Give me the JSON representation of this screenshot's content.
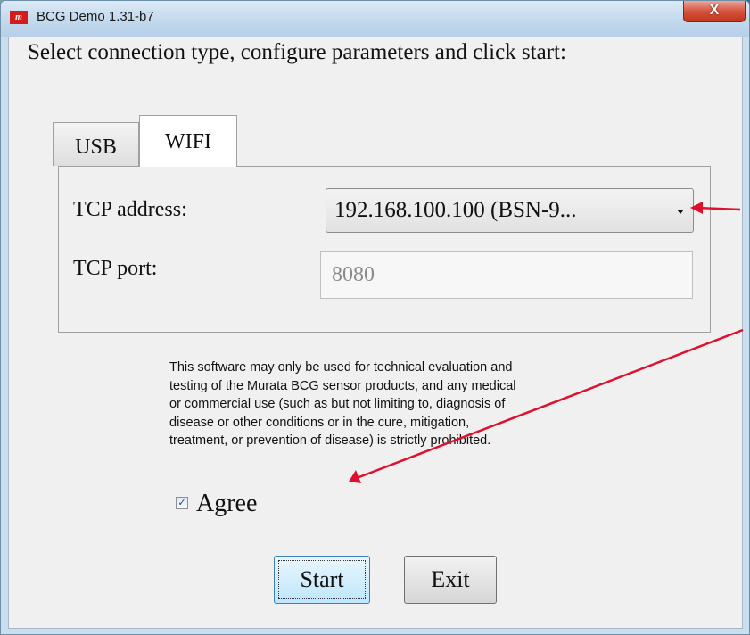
{
  "window": {
    "app_icon_text": "m",
    "title": "BCG Demo 1.31-b7",
    "close_label": "X"
  },
  "instruction": "Select connection type, configure parameters and click start:",
  "tabs": [
    {
      "label": "USB",
      "selected": false
    },
    {
      "label": "WIFI",
      "selected": true
    }
  ],
  "wifi": {
    "tcp_address_label": "TCP address:",
    "tcp_address_value": "192.168.100.100 (BSN-9...",
    "tcp_port_label": "TCP port:",
    "tcp_port_value": "8080"
  },
  "disclaimer_lines": [
    "This software may only be used for technical evaluation and",
    "testing of the Murata BCG sensor products, and any medical",
    "or commercial use (such as but not limiting to, diagnosis of",
    "disease or other conditions or in the cure, mitigation,",
    "treatment, or prevention of disease) is strictly prohibited."
  ],
  "agree": {
    "label": "Agree",
    "checked": true,
    "check_glyph": "✓"
  },
  "buttons": {
    "start": "Start",
    "exit": "Exit"
  },
  "colors": {
    "annotation_arrow": "#e0102c",
    "title_bar": "#c1d8ec",
    "close_button": "#c2341c",
    "start_button": "#bee6fd"
  },
  "icons": {
    "app": "murata-logo-icon",
    "close": "close-icon",
    "dropdown": "chevron-down-icon",
    "checkbox": "checkmark-icon"
  }
}
